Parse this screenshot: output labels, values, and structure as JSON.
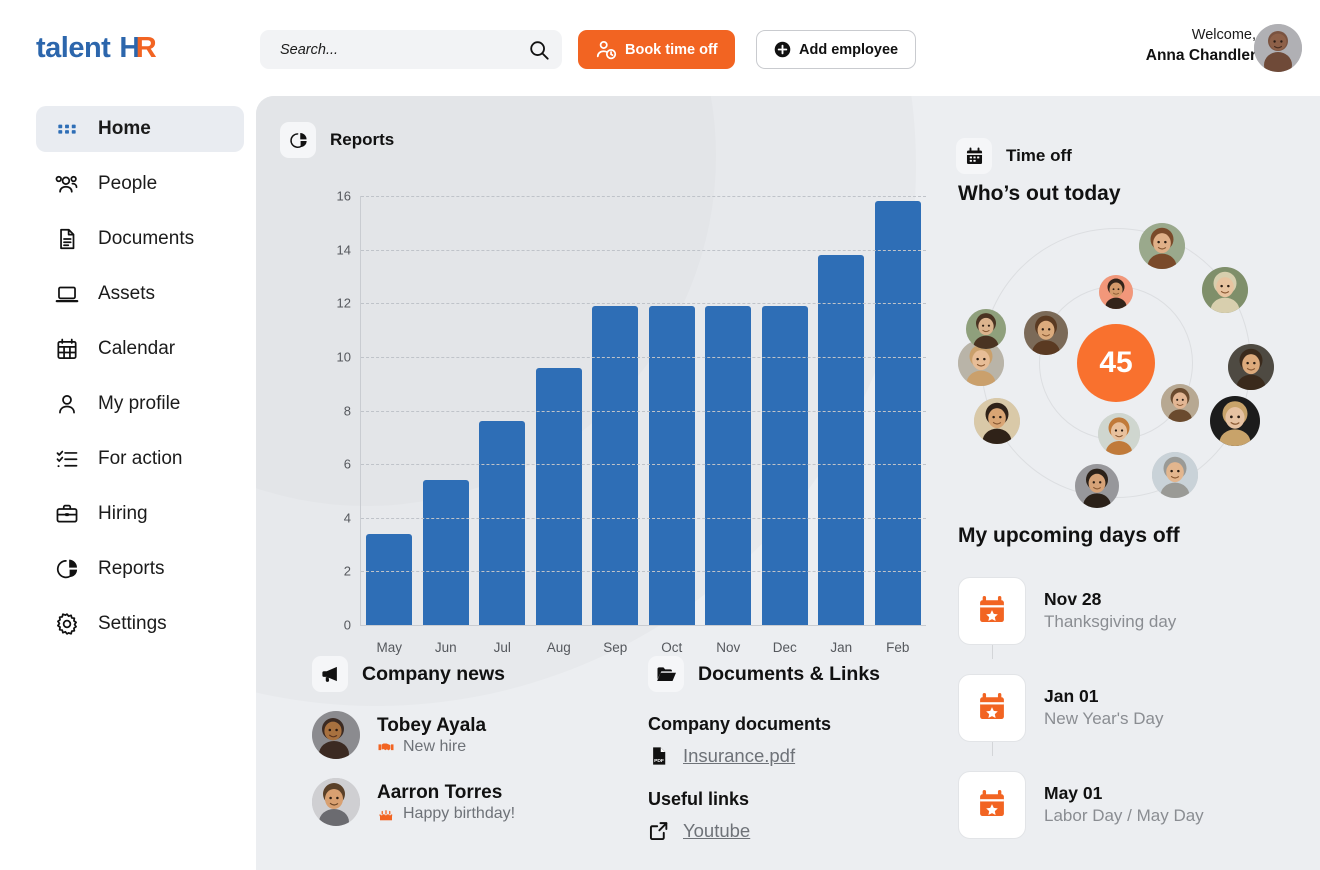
{
  "brand": {
    "name_part1": "talent",
    "name_part2_h": "H",
    "name_part2_r": "R"
  },
  "search": {
    "placeholder": "Search...",
    "value": "",
    "icon": "search-icon"
  },
  "header": {
    "book_time_off": "Book time off",
    "add_employee": "Add employee",
    "welcome_label": "Welcome,",
    "user_name": "Anna Chandler"
  },
  "sidebar": {
    "items": [
      {
        "label": "Home",
        "icon": "grid-icon",
        "active": true
      },
      {
        "label": "People",
        "icon": "people-icon",
        "active": false
      },
      {
        "label": "Documents",
        "icon": "document-icon",
        "active": false
      },
      {
        "label": "Assets",
        "icon": "laptop-icon",
        "active": false
      },
      {
        "label": "Calendar",
        "icon": "calendar-icon",
        "active": false
      },
      {
        "label": "My profile",
        "icon": "user-icon",
        "active": false
      },
      {
        "label": "For action",
        "icon": "checklist-icon",
        "active": false
      },
      {
        "label": "Hiring",
        "icon": "briefcase-icon",
        "active": false
      },
      {
        "label": "Reports",
        "icon": "pie-chart-icon",
        "active": false
      },
      {
        "label": "Settings",
        "icon": "gear-icon",
        "active": false
      }
    ]
  },
  "reports": {
    "title": "Reports",
    "icon": "pie-chart-icon"
  },
  "chart_data": {
    "type": "bar",
    "title": "Reports",
    "categories": [
      "May",
      "Jun",
      "Jul",
      "Aug",
      "Sep",
      "Oct",
      "Nov",
      "Dec",
      "Jan",
      "Feb"
    ],
    "values": [
      3.4,
      5.4,
      7.6,
      9.6,
      11.9,
      11.9,
      11.9,
      11.9,
      13.8,
      15.8
    ],
    "yticks": [
      0,
      2,
      4,
      6,
      8,
      10,
      12,
      14,
      16
    ],
    "ylim": [
      0,
      16
    ],
    "xlabel": "",
    "ylabel": "",
    "grid": true,
    "legend": false,
    "bar_color": "#2E6EB6"
  },
  "company_news": {
    "title": "Company news",
    "icon": "megaphone-icon",
    "items": [
      {
        "name": "Tobey Ayala",
        "status": "New hire",
        "icon": "handshake-icon"
      },
      {
        "name": "Aarron Torres",
        "status": "Happy birthday!",
        "icon": "cake-icon"
      }
    ]
  },
  "documents_links": {
    "title": "Documents & Links",
    "icon": "folder-icon",
    "documents_heading": "Company documents",
    "documents": [
      {
        "label": "Insurance.pdf",
        "icon": "pdf-icon"
      }
    ],
    "links_heading": "Useful links",
    "links": [
      {
        "label": "Youtube",
        "icon": "external-link-icon"
      }
    ]
  },
  "time_off": {
    "title": "Time off",
    "icon": "calendar-filled-icon",
    "whos_out_title": "Who’s out today",
    "count": "45",
    "upcoming_title": "My upcoming days off",
    "upcoming": [
      {
        "date": "Nov 28",
        "desc": "Thanksgiving day",
        "icon": "calendar-star-icon"
      },
      {
        "date": "Jan 01",
        "desc": "New Year's Day",
        "icon": "calendar-star-icon"
      },
      {
        "date": "May 01",
        "desc": "Labor Day / May Day",
        "icon": "calendar-star-icon"
      }
    ]
  },
  "colors": {
    "accent_orange": "#F26422",
    "brand_blue": "#2C66AC",
    "bar_blue": "#2E6EB6",
    "panel_bg": "#ECEEF1",
    "count_orange": "#F9712E"
  }
}
